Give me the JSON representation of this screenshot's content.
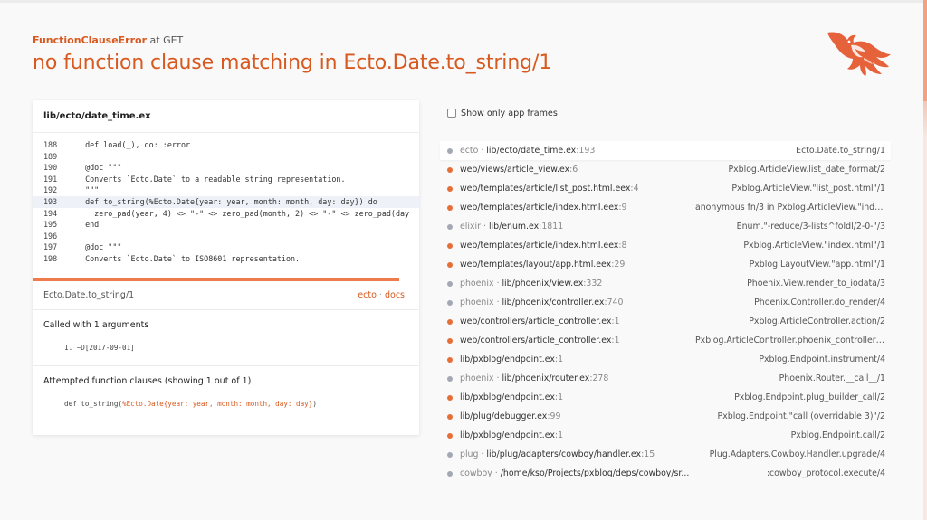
{
  "header": {
    "error_class": "FunctionClauseError",
    "error_at": "at GET",
    "message": "no function clause matching in Ecto.Date.to_string/1",
    "logo_icon": "phoenix-logo-icon"
  },
  "colors": {
    "accent": "#d8591f",
    "app_frame_dot": "#e56f36",
    "dep_frame_dot": "#a3a8b3",
    "highlight_line": "#eef2f8"
  },
  "code_panel": {
    "file": "lib/ecto/date_time.ex",
    "lines": [
      {
        "n": "188",
        "code": "  def load(_), do: :error"
      },
      {
        "n": "189",
        "code": ""
      },
      {
        "n": "190",
        "code": "  @doc \"\"\""
      },
      {
        "n": "191",
        "code": "  Converts `Ecto.Date` to a readable string representation."
      },
      {
        "n": "192",
        "code": "  \"\"\""
      },
      {
        "n": "193",
        "code": "  def to_string(%Ecto.Date{year: year, month: month, day: day}) do"
      },
      {
        "n": "194",
        "code": "    zero_pad(year, 4) <> \"-\" <> zero_pad(month, 2) <> \"-\" <> zero_pad(day"
      },
      {
        "n": "195",
        "code": "  end"
      },
      {
        "n": "196",
        "code": ""
      },
      {
        "n": "197",
        "code": "  @doc \"\"\""
      },
      {
        "n": "198",
        "code": "  Converts `Ecto.Date` to ISO8601 representation."
      }
    ],
    "function": "Ecto.Date.to_string/1",
    "app": "ecto",
    "separator": "·",
    "docs_link": "docs",
    "called_with_title": "Called with 1 arguments",
    "argument": "1.  ~D[2017-09-01]",
    "clauses_title": "Attempted function clauses (showing 1 out of 1)",
    "clause_prefix": "def to_string(",
    "clause_pattern": "%Ecto.Date{year: year, month: month, day: day}",
    "clause_suffix": ")"
  },
  "stack": {
    "app_frames_label": "Show only app frames",
    "frames": [
      {
        "lib": "ecto · ",
        "path": "lib/ecto/date_time.ex",
        "line": ":193",
        "fn": "Ecto.Date.to_string/1",
        "app": false
      },
      {
        "lib": "",
        "path": "web/views/article_view.ex",
        "line": ":6",
        "fn": "Pxblog.ArticleView.list_date_format/2",
        "app": true
      },
      {
        "lib": "",
        "path": "web/templates/article/list_post.html.eex",
        "line": ":4",
        "fn": "Pxblog.ArticleView.\"list_post.html\"/1",
        "app": true
      },
      {
        "lib": "",
        "path": "web/templates/article/index.html.eex",
        "line": ":9",
        "fn": "anonymous fn/3 in Pxblog.ArticleView.\"index.h...",
        "app": true
      },
      {
        "lib": "elixir · ",
        "path": "lib/enum.ex",
        "line": ":1811",
        "fn": "Enum.\"-reduce/3-lists^foldl/2-0-\"/3",
        "app": false
      },
      {
        "lib": "",
        "path": "web/templates/article/index.html.eex",
        "line": ":8",
        "fn": "Pxblog.ArticleView.\"index.html\"/1",
        "app": true
      },
      {
        "lib": "",
        "path": "web/templates/layout/app.html.eex",
        "line": ":29",
        "fn": "Pxblog.LayoutView.\"app.html\"/1",
        "app": true
      },
      {
        "lib": "phoenix · ",
        "path": "lib/phoenix/view.ex",
        "line": ":332",
        "fn": "Phoenix.View.render_to_iodata/3",
        "app": false
      },
      {
        "lib": "phoenix · ",
        "path": "lib/phoenix/controller.ex",
        "line": ":740",
        "fn": "Phoenix.Controller.do_render/4",
        "app": false
      },
      {
        "lib": "",
        "path": "web/controllers/article_controller.ex",
        "line": ":1",
        "fn": "Pxblog.ArticleController.action/2",
        "app": true
      },
      {
        "lib": "",
        "path": "web/controllers/article_controller.ex",
        "line": ":1",
        "fn": "Pxblog.ArticleController.phoenix_controller_pi...",
        "app": true
      },
      {
        "lib": "",
        "path": "lib/pxblog/endpoint.ex",
        "line": ":1",
        "fn": "Pxblog.Endpoint.instrument/4",
        "app": true
      },
      {
        "lib": "phoenix · ",
        "path": "lib/phoenix/router.ex",
        "line": ":278",
        "fn": "Phoenix.Router.__call__/1",
        "app": false
      },
      {
        "lib": "",
        "path": "lib/pxblog/endpoint.ex",
        "line": ":1",
        "fn": "Pxblog.Endpoint.plug_builder_call/2",
        "app": true
      },
      {
        "lib": "",
        "path": "lib/plug/debugger.ex",
        "line": ":99",
        "fn": "Pxblog.Endpoint.\"call (overridable 3)\"/2",
        "app": true
      },
      {
        "lib": "",
        "path": "lib/pxblog/endpoint.ex",
        "line": ":1",
        "fn": "Pxblog.Endpoint.call/2",
        "app": true
      },
      {
        "lib": "plug · ",
        "path": "lib/plug/adapters/cowboy/handler.ex",
        "line": ":15",
        "fn": "Plug.Adapters.Cowboy.Handler.upgrade/4",
        "app": false
      },
      {
        "lib": "cowboy · ",
        "path": "/home/kso/Projects/pxblog/deps/cowboy/sr...",
        "line": "",
        "fn": ":cowboy_protocol.execute/4",
        "app": false
      }
    ]
  }
}
